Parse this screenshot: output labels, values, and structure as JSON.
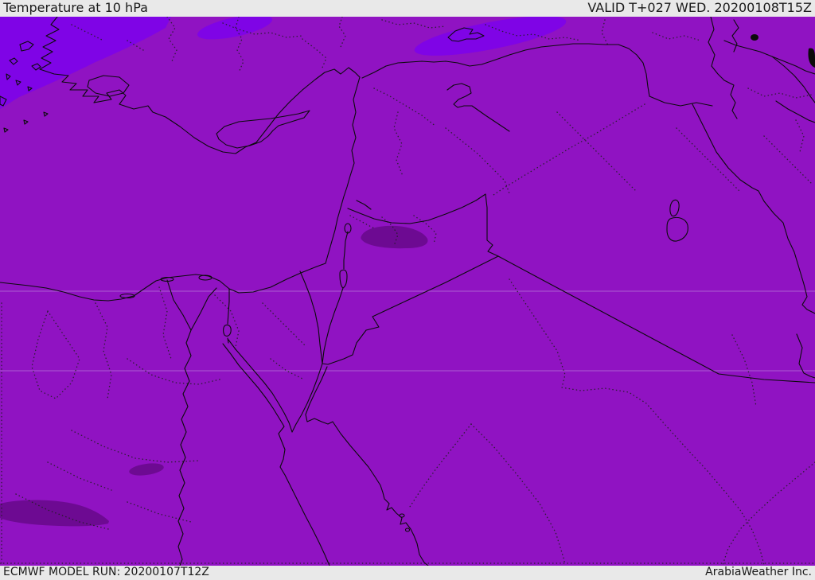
{
  "header": {
    "title": "Temperature at 10 hPa",
    "validity": "VALID T+027 WED. 20200108T15Z"
  },
  "footer": {
    "model_run": "ECMWF MODEL RUN: 20200107T12Z",
    "credit": "ArabiaWeather Inc."
  },
  "map": {
    "colors": {
      "base": "#9013C2",
      "violet_patch": "#7F04E6",
      "dark_patch": "#6D0A92",
      "line": "#0B0B0B",
      "dotted": "#1E1E1E",
      "grid": "#DCD2EE",
      "bar_bg": "#E9E9E9",
      "bar_text": "#1A1A1A"
    }
  }
}
